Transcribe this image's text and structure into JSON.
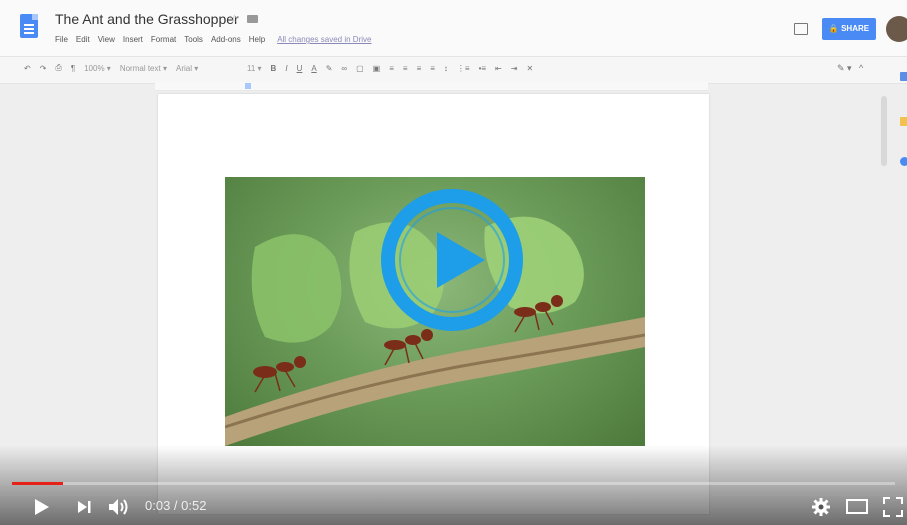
{
  "doc": {
    "title": "The Ant and the Grasshopper",
    "menu": [
      "File",
      "Edit",
      "View",
      "Insert",
      "Format",
      "Tools",
      "Add-ons",
      "Help"
    ],
    "saved_status": "All changes saved in Drive",
    "share_label": "SHARE"
  },
  "toolbar": {
    "zoom": "100%",
    "style": "Normal text",
    "font": "Arial",
    "size": "11"
  },
  "video": {
    "current_time": "0:03",
    "duration": "0:52",
    "progress": 0.058
  },
  "colors": {
    "play_ring": "#1e9ee8",
    "progress": "#e62117",
    "share": "#4a8af4"
  },
  "icons": [
    "doc-icon",
    "star-icon",
    "folder-icon",
    "comment-icon",
    "avatar",
    "play-icon",
    "next-icon",
    "volume-icon",
    "settings-icon",
    "theater-icon",
    "fullscreen-icon"
  ]
}
